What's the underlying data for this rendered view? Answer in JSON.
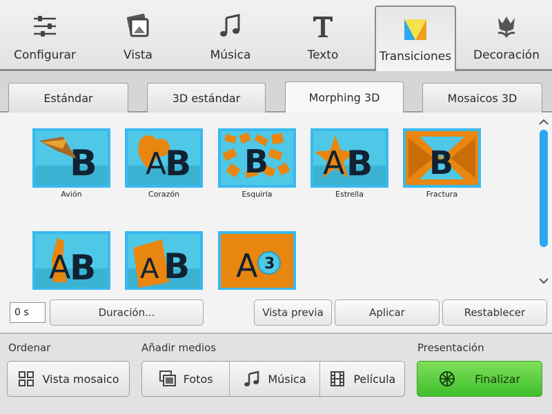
{
  "top_tabs": [
    {
      "label": "Configurar",
      "icon": "sliders-icon"
    },
    {
      "label": "Vista",
      "icon": "photo-stack-icon"
    },
    {
      "label": "Música",
      "icon": "music-note-icon"
    },
    {
      "label": "Texto",
      "icon": "text-t-icon"
    },
    {
      "label": "Transiciones",
      "icon": "transitions-icon",
      "active": true
    },
    {
      "label": "Decoración",
      "icon": "tulip-icon"
    }
  ],
  "sub_tabs": [
    {
      "label": "Estándar"
    },
    {
      "label": "3D estándar"
    },
    {
      "label": "Morphing 3D",
      "active": true
    },
    {
      "label": "Mosaicos 3D"
    }
  ],
  "transitions": [
    {
      "label": "Avión"
    },
    {
      "label": "Corazón"
    },
    {
      "label": "Esquirla"
    },
    {
      "label": "Estrella"
    },
    {
      "label": "Fractura"
    },
    {
      "label": ""
    },
    {
      "label": ""
    },
    {
      "label": ""
    }
  ],
  "controls": {
    "duration_value": "0 s",
    "duration_button": "Duración...",
    "preview_button": "Vista previa",
    "apply_button": "Aplicar",
    "reset_button": "Restablecer"
  },
  "bottom": {
    "sort_label": "Ordenar",
    "mosaic_view_button": "Vista mosaico",
    "add_media_label": "Añadir medios",
    "photos_button": "Fotos",
    "music_button": "Música",
    "movie_button": "Película",
    "presentation_label": "Presentación",
    "finalize_button": "Finalizar"
  },
  "colors": {
    "thumb_border": "#39b9f0",
    "thumb_cyan": "#4ec8e6",
    "thumb_orange": "#e8860f",
    "scroll_accent": "#2aa8f0",
    "finalize_green": "#4cc935"
  }
}
